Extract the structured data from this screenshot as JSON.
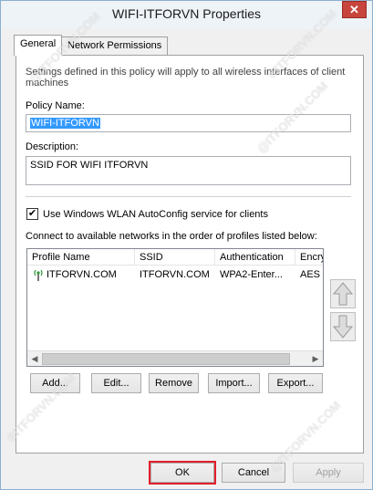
{
  "window": {
    "title": "WIFI-ITFORVN Properties",
    "close_glyph": "✕"
  },
  "tabs": [
    {
      "label": "General",
      "active": true
    },
    {
      "label": "Network Permissions",
      "active": false
    }
  ],
  "general": {
    "info_text_line1": "Settings defined in this policy will apply to all wireless interfaces of client",
    "info_text_line2": "machines",
    "policy_name_label": "Policy Name:",
    "policy_name_value": "WIFI-ITFORVN",
    "description_label": "Description:",
    "description_value": "SSID FOR WIFI ITFORVN",
    "autoconfig_checked": true,
    "autoconfig_label": "Use Windows WLAN AutoConfig service for clients",
    "connect_text": "Connect to available networks in the order of profiles listed below:"
  },
  "profiles": {
    "columns": [
      "Profile Name",
      "SSID",
      "Authentication",
      "Encry"
    ],
    "rows": [
      {
        "profile_name": "ITFORVN.COM",
        "ssid": "ITFORVN.COM",
        "authentication": "WPA2-Enter...",
        "encryption": "AES"
      }
    ],
    "scroll_left": "◀",
    "scroll_right": "▶"
  },
  "profile_buttons": {
    "add": "Add...",
    "edit": "Edit...",
    "remove": "Remove",
    "import": "Import...",
    "export": "Export..."
  },
  "dialog_buttons": {
    "ok": "OK",
    "cancel": "Cancel",
    "apply": "Apply"
  },
  "watermarks": [
    "@ITFORVN.COM",
    "®ITFORVN.COM",
    "@ITFORVN.COM",
    "®ITFORVN.COM",
    "@ITFORVN.COM"
  ],
  "colors": {
    "selection": "#3399ff",
    "focus_outline": "#e2202a"
  },
  "icons": {
    "wifi_profile": "wifi-signal-icon",
    "move_up": "arrow-up-icon",
    "move_down": "arrow-down-icon"
  }
}
